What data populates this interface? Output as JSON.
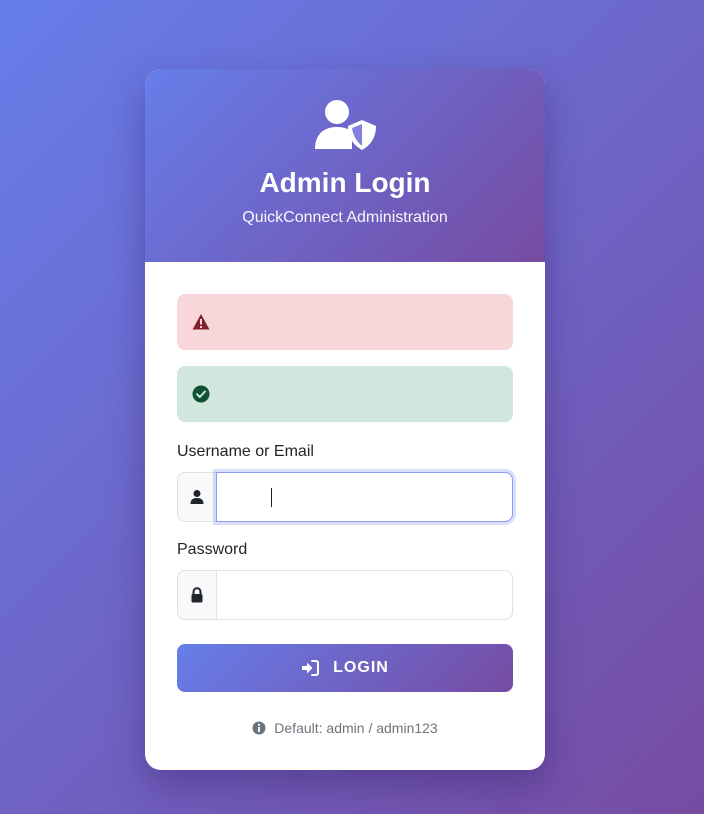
{
  "header": {
    "icon": "user-shield-icon",
    "title": "Admin Login",
    "subtitle": "QuickConnect Administration"
  },
  "alerts": {
    "danger": {
      "icon": "warning-triangle-icon",
      "text": ""
    },
    "success": {
      "icon": "check-circle-icon",
      "text": ""
    }
  },
  "form": {
    "username": {
      "label": "Username or Email",
      "icon": "user-icon",
      "value": "",
      "placeholder": ""
    },
    "password": {
      "label": "Password",
      "icon": "lock-icon",
      "value": "",
      "placeholder": ""
    },
    "submit": {
      "icon": "sign-in-icon",
      "label": "LOGIN"
    }
  },
  "hint": {
    "icon": "info-circle-icon",
    "text": "Default: admin / admin123"
  },
  "colors": {
    "gradient_start": "#667eea",
    "gradient_end": "#764ba2",
    "danger_bg": "#f8d7da",
    "success_bg": "#d1e7dd",
    "danger_icon": "#842029",
    "success_icon": "#0f5132"
  }
}
